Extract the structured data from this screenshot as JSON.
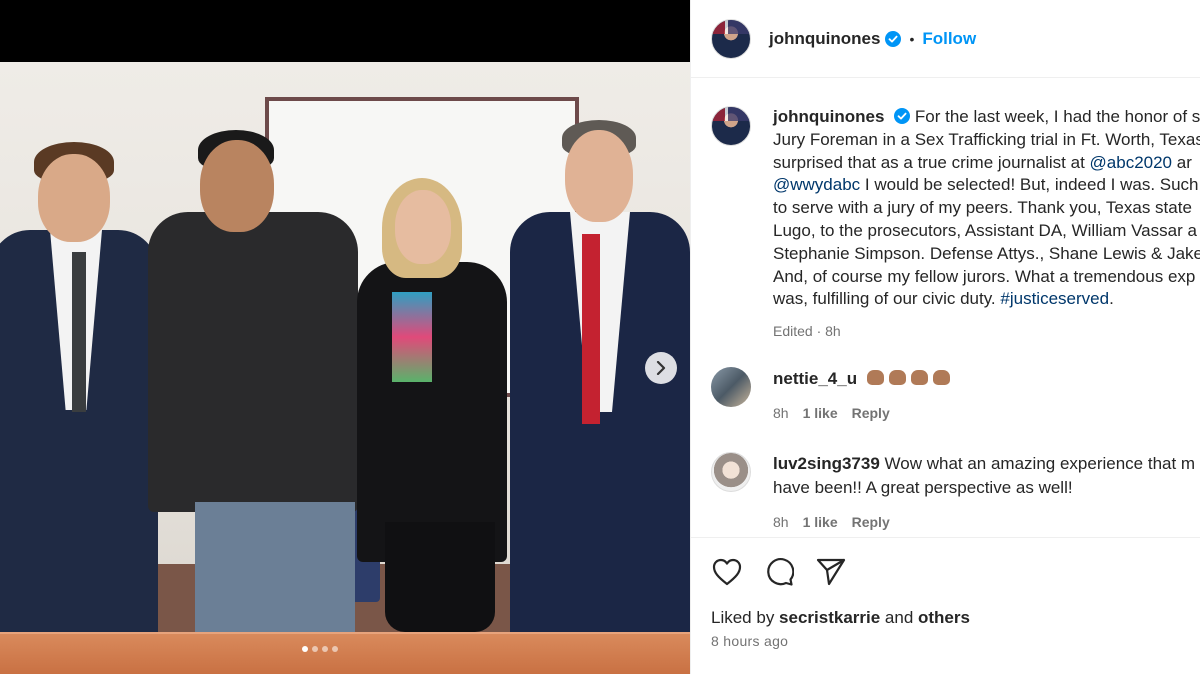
{
  "post": {
    "username": "johnquinones",
    "follow_label": "Follow",
    "separator": "•"
  },
  "caption": {
    "username": "johnquinones",
    "lines": [
      "For the last week, I had the honor of s",
      "Jury Foreman in a Sex Trafficking trial in Ft. Worth, Texas",
      "surprised that as a true crime journalist at ",
      "I would be selected! But, indeed I was. Such",
      "to serve with a jury of my peers. Thank you, Texas state",
      "Lugo, to the prosecutors, Assistant DA, William Vassar a",
      "Stephanie Simpson. Defense Attys., Shane Lewis & Jake",
      "And, of course my fellow jurors. What a tremendous exp",
      "was, fulfilling of our civic duty. "
    ],
    "mention_1": "@abc2020",
    "after_mention_1": " ar",
    "mention_2": "@wwydabc",
    "hashtag": "#justiceserved",
    "after_hashtag": ".",
    "edited": "Edited · 8h"
  },
  "comments": [
    {
      "username": "nettie_4_u",
      "text": "",
      "time": "8h",
      "likes": "1 like",
      "reply": "Reply"
    },
    {
      "username": "luv2sing3739",
      "text": "Wow what an amazing experience that m",
      "text_line2": "have been!! A great perspective as well!",
      "time": "8h",
      "likes": "1 like",
      "reply": "Reply"
    }
  ],
  "likes": {
    "prefix": "Liked by ",
    "user": "secristkarrie",
    "middle": " and ",
    "others": "others"
  },
  "posted_ago": "8 hours ago",
  "icons": {
    "like": "heart-icon",
    "comment": "comment-icon",
    "share": "share-icon",
    "next": "chevron-right-icon",
    "verified": "verified-badge-icon"
  },
  "carousel": {
    "total": 4,
    "active_index": 0
  },
  "colors": {
    "link": "#00376b",
    "follow": "#0095f6",
    "verified": "#0095f6",
    "muted": "#737373"
  }
}
